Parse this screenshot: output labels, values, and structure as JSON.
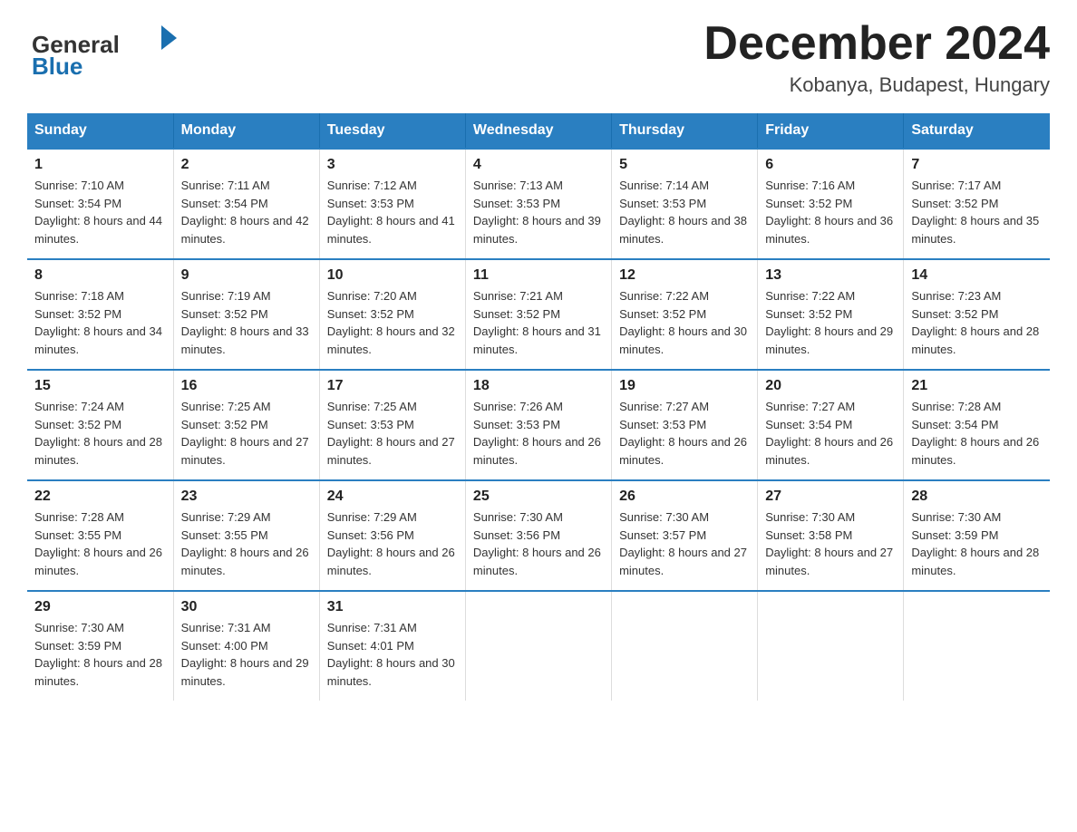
{
  "header": {
    "logo": {
      "general": "General",
      "blue": "Blue",
      "arrow_char": "▶"
    },
    "title": "December 2024",
    "location": "Kobanya, Budapest, Hungary"
  },
  "days_of_week": [
    "Sunday",
    "Monday",
    "Tuesday",
    "Wednesday",
    "Thursday",
    "Friday",
    "Saturday"
  ],
  "weeks": [
    [
      {
        "day": "1",
        "sunrise": "7:10 AM",
        "sunset": "3:54 PM",
        "daylight": "8 hours and 44 minutes."
      },
      {
        "day": "2",
        "sunrise": "7:11 AM",
        "sunset": "3:54 PM",
        "daylight": "8 hours and 42 minutes."
      },
      {
        "day": "3",
        "sunrise": "7:12 AM",
        "sunset": "3:53 PM",
        "daylight": "8 hours and 41 minutes."
      },
      {
        "day": "4",
        "sunrise": "7:13 AM",
        "sunset": "3:53 PM",
        "daylight": "8 hours and 39 minutes."
      },
      {
        "day": "5",
        "sunrise": "7:14 AM",
        "sunset": "3:53 PM",
        "daylight": "8 hours and 38 minutes."
      },
      {
        "day": "6",
        "sunrise": "7:16 AM",
        "sunset": "3:52 PM",
        "daylight": "8 hours and 36 minutes."
      },
      {
        "day": "7",
        "sunrise": "7:17 AM",
        "sunset": "3:52 PM",
        "daylight": "8 hours and 35 minutes."
      }
    ],
    [
      {
        "day": "8",
        "sunrise": "7:18 AM",
        "sunset": "3:52 PM",
        "daylight": "8 hours and 34 minutes."
      },
      {
        "day": "9",
        "sunrise": "7:19 AM",
        "sunset": "3:52 PM",
        "daylight": "8 hours and 33 minutes."
      },
      {
        "day": "10",
        "sunrise": "7:20 AM",
        "sunset": "3:52 PM",
        "daylight": "8 hours and 32 minutes."
      },
      {
        "day": "11",
        "sunrise": "7:21 AM",
        "sunset": "3:52 PM",
        "daylight": "8 hours and 31 minutes."
      },
      {
        "day": "12",
        "sunrise": "7:22 AM",
        "sunset": "3:52 PM",
        "daylight": "8 hours and 30 minutes."
      },
      {
        "day": "13",
        "sunrise": "7:22 AM",
        "sunset": "3:52 PM",
        "daylight": "8 hours and 29 minutes."
      },
      {
        "day": "14",
        "sunrise": "7:23 AM",
        "sunset": "3:52 PM",
        "daylight": "8 hours and 28 minutes."
      }
    ],
    [
      {
        "day": "15",
        "sunrise": "7:24 AM",
        "sunset": "3:52 PM",
        "daylight": "8 hours and 28 minutes."
      },
      {
        "day": "16",
        "sunrise": "7:25 AM",
        "sunset": "3:52 PM",
        "daylight": "8 hours and 27 minutes."
      },
      {
        "day": "17",
        "sunrise": "7:25 AM",
        "sunset": "3:53 PM",
        "daylight": "8 hours and 27 minutes."
      },
      {
        "day": "18",
        "sunrise": "7:26 AM",
        "sunset": "3:53 PM",
        "daylight": "8 hours and 26 minutes."
      },
      {
        "day": "19",
        "sunrise": "7:27 AM",
        "sunset": "3:53 PM",
        "daylight": "8 hours and 26 minutes."
      },
      {
        "day": "20",
        "sunrise": "7:27 AM",
        "sunset": "3:54 PM",
        "daylight": "8 hours and 26 minutes."
      },
      {
        "day": "21",
        "sunrise": "7:28 AM",
        "sunset": "3:54 PM",
        "daylight": "8 hours and 26 minutes."
      }
    ],
    [
      {
        "day": "22",
        "sunrise": "7:28 AM",
        "sunset": "3:55 PM",
        "daylight": "8 hours and 26 minutes."
      },
      {
        "day": "23",
        "sunrise": "7:29 AM",
        "sunset": "3:55 PM",
        "daylight": "8 hours and 26 minutes."
      },
      {
        "day": "24",
        "sunrise": "7:29 AM",
        "sunset": "3:56 PM",
        "daylight": "8 hours and 26 minutes."
      },
      {
        "day": "25",
        "sunrise": "7:30 AM",
        "sunset": "3:56 PM",
        "daylight": "8 hours and 26 minutes."
      },
      {
        "day": "26",
        "sunrise": "7:30 AM",
        "sunset": "3:57 PM",
        "daylight": "8 hours and 27 minutes."
      },
      {
        "day": "27",
        "sunrise": "7:30 AM",
        "sunset": "3:58 PM",
        "daylight": "8 hours and 27 minutes."
      },
      {
        "day": "28",
        "sunrise": "7:30 AM",
        "sunset": "3:59 PM",
        "daylight": "8 hours and 28 minutes."
      }
    ],
    [
      {
        "day": "29",
        "sunrise": "7:30 AM",
        "sunset": "3:59 PM",
        "daylight": "8 hours and 28 minutes."
      },
      {
        "day": "30",
        "sunrise": "7:31 AM",
        "sunset": "4:00 PM",
        "daylight": "8 hours and 29 minutes."
      },
      {
        "day": "31",
        "sunrise": "7:31 AM",
        "sunset": "4:01 PM",
        "daylight": "8 hours and 30 minutes."
      },
      null,
      null,
      null,
      null
    ]
  ],
  "labels": {
    "sunrise": "Sunrise:",
    "sunset": "Sunset:",
    "daylight": "Daylight:"
  }
}
